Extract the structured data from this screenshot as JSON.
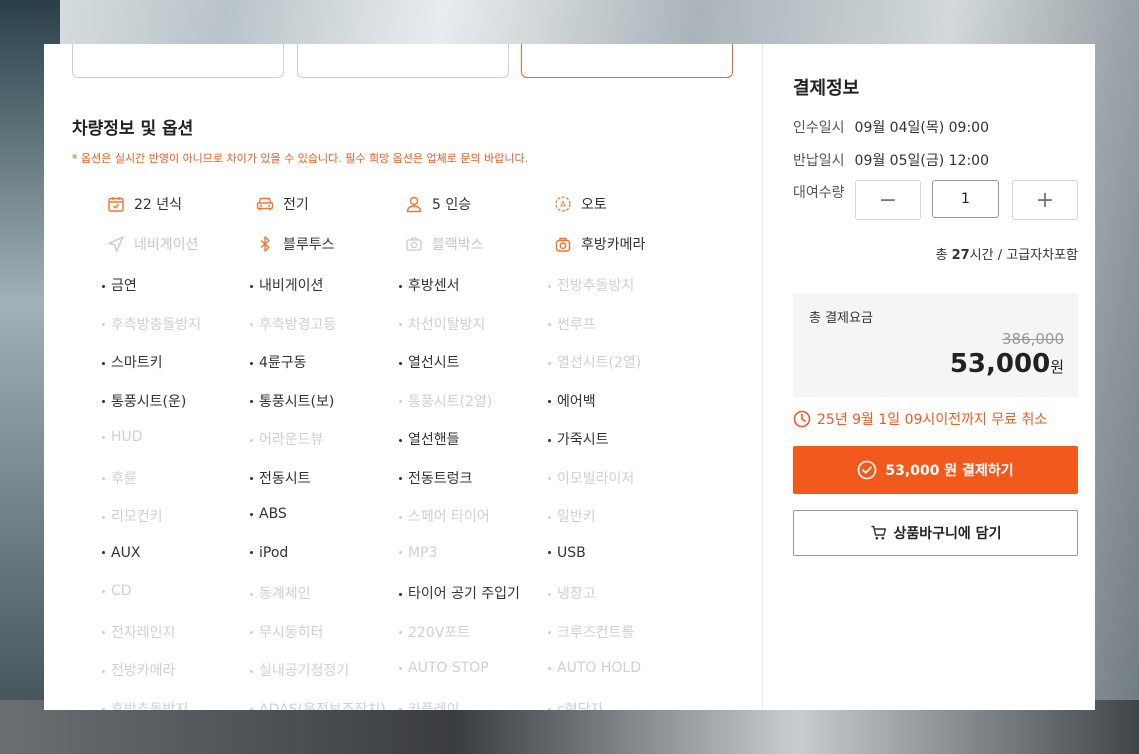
{
  "vehicle": {
    "title": "차량정보 및 옵션",
    "notice": "* 옵션은 실시간 반영이 아니므로 차이가 있을 수 있습니다. 필수 희망 옵션은 업체로 문의 바랍니다.",
    "specs": [
      {
        "label": "22 년식",
        "icon": "calendar-icon",
        "enabled": true
      },
      {
        "label": "전기",
        "icon": "car-icon",
        "enabled": true
      },
      {
        "label": "5 인승",
        "icon": "person-icon",
        "enabled": true
      },
      {
        "label": "오토",
        "icon": "auto-transmission-icon",
        "enabled": true
      },
      {
        "label": "네비게이션",
        "icon": "navigation-icon",
        "enabled": false
      },
      {
        "label": "블루투스",
        "icon": "bluetooth-icon",
        "enabled": true
      },
      {
        "label": "블랙박스",
        "icon": "camera-icon",
        "enabled": false
      },
      {
        "label": "후방카메라",
        "icon": "rear-camera-icon",
        "enabled": true
      }
    ],
    "options": [
      {
        "label": "금연",
        "enabled": true
      },
      {
        "label": "내비게이션",
        "enabled": true
      },
      {
        "label": "후방센서",
        "enabled": true
      },
      {
        "label": "전방추돌방지",
        "enabled": false
      },
      {
        "label": "후측방충돌방지",
        "enabled": false
      },
      {
        "label": "후측방경고등",
        "enabled": false
      },
      {
        "label": "차선이탈방지",
        "enabled": false
      },
      {
        "label": "썬루프",
        "enabled": false
      },
      {
        "label": "스마트키",
        "enabled": true
      },
      {
        "label": "4륜구동",
        "enabled": true
      },
      {
        "label": "열선시트",
        "enabled": true
      },
      {
        "label": "열선시트(2열)",
        "enabled": false
      },
      {
        "label": "통풍시트(운)",
        "enabled": true
      },
      {
        "label": "통풍시트(보)",
        "enabled": true
      },
      {
        "label": "통풍시트(2열)",
        "enabled": false
      },
      {
        "label": "에어백",
        "enabled": true
      },
      {
        "label": "HUD",
        "enabled": false
      },
      {
        "label": "어라운드뷰",
        "enabled": false
      },
      {
        "label": "열선핸들",
        "enabled": true
      },
      {
        "label": "가죽시트",
        "enabled": true
      },
      {
        "label": "후륜",
        "enabled": false
      },
      {
        "label": "전동시트",
        "enabled": true
      },
      {
        "label": "전동트렁크",
        "enabled": true
      },
      {
        "label": "이모빌라이저",
        "enabled": false
      },
      {
        "label": "리모컨키",
        "enabled": false
      },
      {
        "label": "ABS",
        "enabled": true
      },
      {
        "label": "스페어 타이어",
        "enabled": false
      },
      {
        "label": "일반키",
        "enabled": false
      },
      {
        "label": "AUX",
        "enabled": true
      },
      {
        "label": "iPod",
        "enabled": true
      },
      {
        "label": "MP3",
        "enabled": false
      },
      {
        "label": "USB",
        "enabled": true
      },
      {
        "label": "CD",
        "enabled": false
      },
      {
        "label": "동계체인",
        "enabled": false
      },
      {
        "label": "타이어 공기 주입기",
        "enabled": true
      },
      {
        "label": "냉장고",
        "enabled": false
      },
      {
        "label": "전자레인지",
        "enabled": false
      },
      {
        "label": "무시동히터",
        "enabled": false
      },
      {
        "label": "220V포트",
        "enabled": false
      },
      {
        "label": "크루즈컨트롤",
        "enabled": false
      },
      {
        "label": "전방카메라",
        "enabled": false
      },
      {
        "label": "실내공기청정기",
        "enabled": false
      },
      {
        "label": "AUTO STOP",
        "enabled": false
      },
      {
        "label": "AUTO HOLD",
        "enabled": false
      },
      {
        "label": "후방추돌방지",
        "enabled": false
      },
      {
        "label": "ADAS(운전보조장치)",
        "enabled": false
      },
      {
        "label": "카플레이",
        "enabled": false
      },
      {
        "label": "c형단자",
        "enabled": false
      }
    ]
  },
  "payment": {
    "title": "결제정보",
    "pickup_label": "인수일시",
    "pickup_value": "09월 04일(목) 09:00",
    "return_label": "반납일시",
    "return_value": "09월 05일(금) 12:00",
    "quantity_label": "대여수량",
    "quantity": "1",
    "minus": "−",
    "plus": "+",
    "total_time_prefix": "총 ",
    "total_time_hours": "27",
    "total_time_suffix": "시간 / 고급자차포함",
    "total_label": "총 결제요금",
    "original_price": "386,000",
    "price": "53,000",
    "price_unit": "원",
    "cancel_notice": "25년 9월 1일 09시이전까지 무료 취소",
    "pay_button": "53,000 원 결제하기",
    "cart_button": "상품바구니에 담기",
    "accent_color": "#f25a1d"
  }
}
